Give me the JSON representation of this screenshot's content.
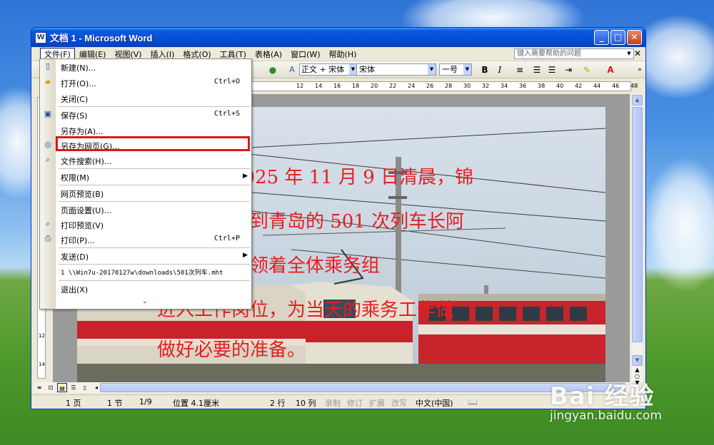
{
  "window": {
    "title": "文档 1 - Microsoft Word",
    "app_icon": "W"
  },
  "menubar": {
    "items": [
      "文件(F)",
      "编辑(E)",
      "视图(V)",
      "插入(I)",
      "格式(O)",
      "工具(T)",
      "表格(A)",
      "窗口(W)",
      "帮助(H)"
    ],
    "help_placeholder": "键入需要帮助的问题"
  },
  "format_toolbar": {
    "style": "正文 + 宋体",
    "font": "宋体",
    "size": "一号"
  },
  "ruler": {
    "ticks": [
      "12",
      "14",
      "16",
      "18",
      "20",
      "22",
      "24",
      "26",
      "28",
      "30",
      "32",
      "34",
      "36",
      "38",
      "40",
      "42",
      "44",
      "46",
      "48"
    ],
    "vticks": [
      "12",
      "14"
    ]
  },
  "file_menu": {
    "items": [
      {
        "label": "新建(N)...",
        "shortcut": "",
        "icon": "new-doc-icon"
      },
      {
        "label": "打开(O)...",
        "shortcut": "Ctrl+O",
        "icon": "open-folder-icon"
      },
      {
        "label": "关闭(C)",
        "shortcut": "",
        "icon": ""
      },
      {
        "label": "保存(S)",
        "shortcut": "Ctrl+S",
        "icon": "save-icon"
      },
      {
        "label": "另存为(A)...",
        "shortcut": "",
        "icon": ""
      },
      {
        "label": "另存为网页(G)...",
        "shortcut": "",
        "icon": "web-save-icon"
      },
      {
        "label": "文件搜索(H)...",
        "shortcut": "",
        "icon": "file-search-icon"
      },
      {
        "label": "权限(M)",
        "shortcut": "",
        "icon": ""
      },
      {
        "label": "网页预览(B)",
        "shortcut": "",
        "icon": ""
      },
      {
        "label": "页面设置(U)...",
        "shortcut": "",
        "icon": ""
      },
      {
        "label": "打印预览(V)",
        "shortcut": "",
        "icon": "print-preview-icon"
      },
      {
        "label": "打印(P)...",
        "shortcut": "Ctrl+P",
        "icon": "print-icon"
      },
      {
        "label": "发送(D)",
        "shortcut": "",
        "icon": ""
      },
      {
        "label": "1 \\\\Win7u-20170127w\\downloads\\501次列车.mht",
        "shortcut": "",
        "icon": ""
      },
      {
        "label": "退出(X)",
        "shortcut": "",
        "icon": ""
      }
    ]
  },
  "document": {
    "lines": [
      "2025 年 11 月 9 日清晨，锦",
      "区到青岛的 501 次列车长阿",
      "带领着全体乘务组",
      "进入工作岗位，为当天的乘务工作做",
      "做好必要的准备。"
    ]
  },
  "status": {
    "page": "1 页",
    "section": "1 节",
    "pages": "1/9",
    "position": "位置 4.1厘米",
    "line": "2 行",
    "column": "10 列",
    "rec": "录制",
    "trk": "修订",
    "ext": "扩展",
    "ovr": "改写",
    "lang": "中文(中国)"
  },
  "watermark": {
    "logo": "Bai 经验",
    "url": "jingyan.baidu.com"
  },
  "colors": {
    "title_blue": "#0350d9",
    "highlight_red": "#e3141b",
    "doc_text_red": "#e81e1e"
  }
}
